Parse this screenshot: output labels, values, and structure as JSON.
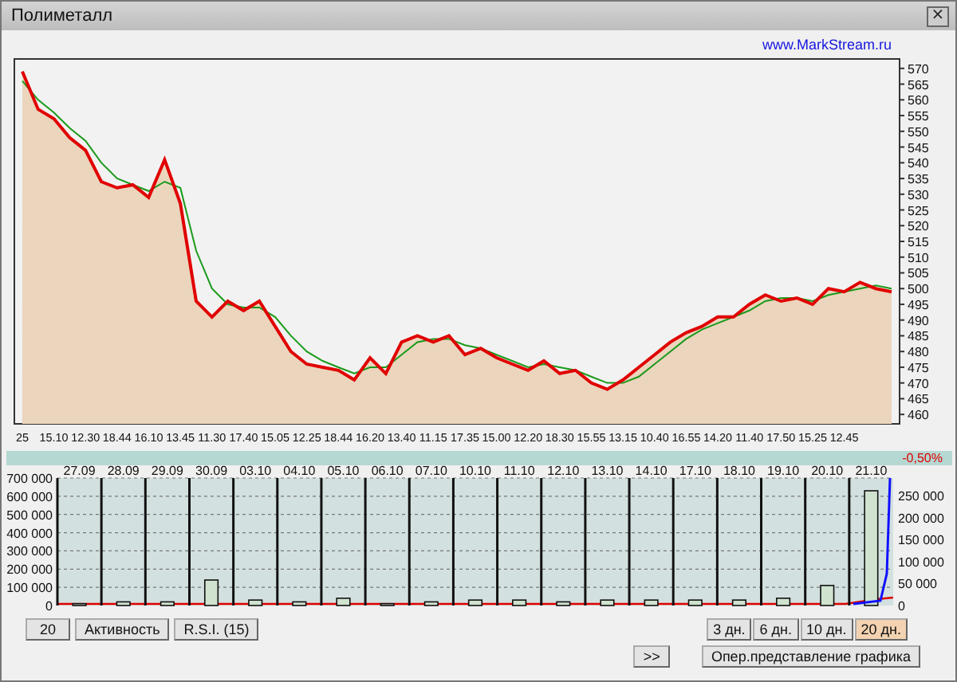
{
  "window": {
    "title": "Полиметалл",
    "close": "×"
  },
  "price_chart": {
    "link": "www.MarkStream.ru",
    "chart_data": {
      "type": "line",
      "categories": [
        "25",
        null,
        "15.10",
        null,
        "12.30",
        null,
        "18.44",
        null,
        "16.10",
        null,
        "13.45",
        null,
        "11.30",
        null,
        "17.40",
        null,
        "15.05",
        null,
        "12.25",
        null,
        "18.44",
        null,
        "16.20",
        null,
        "13.40",
        null,
        "11.15",
        null,
        "17.35",
        null,
        "15.00",
        null,
        "12.20",
        null,
        "18.30",
        null,
        "15.55",
        null,
        "13.15",
        null,
        "10.40",
        null,
        "16.55",
        null,
        "14.20",
        null,
        "11.40",
        null,
        "17.50",
        null,
        "15.25",
        null,
        "12.45",
        null,
        null,
        null
      ],
      "series": [
        {
          "type": "area",
          "color": "#e00000",
          "values": [
            569,
            557,
            554,
            548,
            544,
            534,
            532,
            533,
            529,
            541,
            527,
            496,
            491,
            496,
            493,
            496,
            488,
            480,
            476,
            475,
            474,
            471,
            478,
            473,
            483,
            485,
            483,
            485,
            479,
            481,
            478,
            476,
            474,
            477,
            473,
            474,
            470,
            468,
            471,
            475,
            479,
            483,
            486,
            488,
            491,
            491,
            495,
            498,
            496,
            497,
            495,
            500,
            499,
            502,
            500,
            499
          ]
        },
        {
          "type": "line",
          "color": "#1a9a1a",
          "values": [
            566,
            560,
            556,
            551,
            547,
            540,
            535,
            533,
            531,
            534,
            532,
            512,
            500,
            495,
            494,
            494,
            491,
            485,
            480,
            477,
            475,
            473,
            475,
            475,
            479,
            483,
            484,
            484,
            482,
            481,
            479,
            477,
            475,
            476,
            475,
            474,
            472,
            470,
            470,
            472,
            476,
            480,
            484,
            487,
            489,
            491,
            493,
            496,
            497,
            497,
            496,
            498,
            499,
            500,
            501,
            500
          ]
        }
      ],
      "ylim": [
        457,
        573
      ],
      "yticks": [
        460,
        465,
        470,
        475,
        480,
        485,
        490,
        495,
        500,
        505,
        510,
        515,
        520,
        525,
        530,
        535,
        540,
        545,
        550,
        555,
        560,
        565,
        570
      ]
    }
  },
  "change": "-0,50%",
  "volume_chart": {
    "right_axis_labels": [
      "250 000",
      "200 000",
      "150 000",
      "100 000",
      "50 000",
      "0"
    ],
    "chart_data": {
      "type": "bar",
      "categories": [
        "27.09",
        "28.09",
        "29.09",
        "30.09",
        "03.10",
        "04.10",
        "05.10",
        "06.10",
        "07.10",
        "10.10",
        "11.10",
        "12.10",
        "13.10",
        "14.10",
        "17.10",
        "18.10",
        "19.10",
        "20.10",
        "21.10"
      ],
      "values": [
        10000,
        20000,
        20000,
        140000,
        30000,
        20000,
        40000,
        10000,
        20000,
        30000,
        30000,
        20000,
        30000,
        30000,
        30000,
        30000,
        40000,
        110000,
        630000
      ],
      "ylim": [
        0,
        700000
      ],
      "grid": true,
      "yticks": [
        {
          "value": 0,
          "label": "0"
        },
        {
          "value": 100000,
          "label": "100 000"
        },
        {
          "value": 200000,
          "label": "200 000"
        },
        {
          "value": 300000,
          "label": "300 000"
        },
        {
          "value": 400000,
          "label": "400 000"
        },
        {
          "value": 500000,
          "label": "500 000"
        },
        {
          "value": 600000,
          "label": "600 000"
        },
        {
          "value": 700000,
          "label": "700 000"
        }
      ]
    }
  },
  "tool_buttons": [
    "20",
    "Активность",
    "R.S.I. (15)"
  ],
  "ranges": [
    {
      "label": "3 дн.",
      "selected": false
    },
    {
      "label": "6 дн.",
      "selected": false
    },
    {
      "label": "10 дн.",
      "selected": false
    },
    {
      "label": "20 дн.",
      "selected": true
    }
  ],
  "next_button": ">>",
  "mode_button": "Опер.представление графика"
}
